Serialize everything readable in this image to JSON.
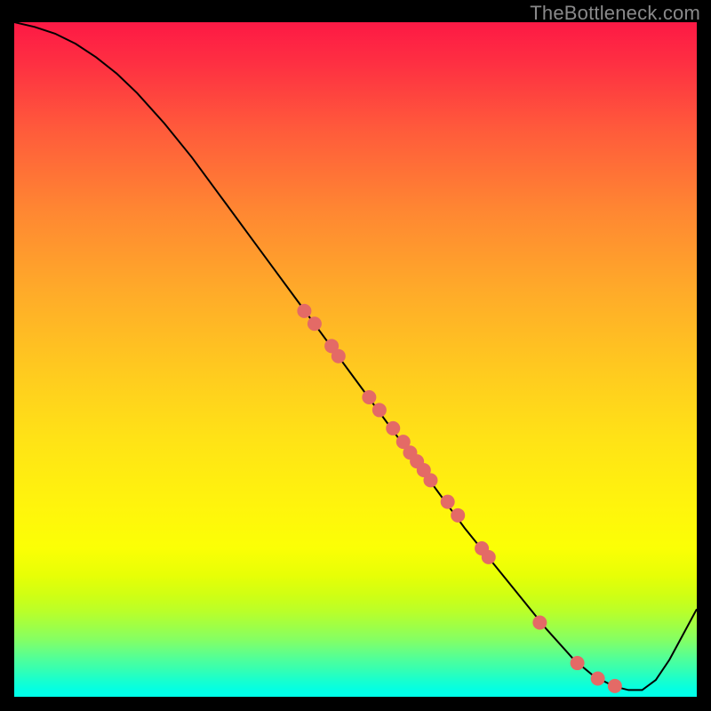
{
  "watermark": "TheBottleneck.com",
  "chart_data": {
    "type": "line",
    "title": "",
    "xlabel": "",
    "ylabel": "",
    "xlim": [
      0,
      100
    ],
    "ylim": [
      0,
      100
    ],
    "series": [
      {
        "name": "curve",
        "color": "#000000",
        "x": [
          0,
          3,
          6,
          9,
          12,
          15,
          18,
          22,
          26,
          30,
          34,
          38,
          42,
          46,
          50,
          54,
          58,
          62,
          66,
          70,
          74,
          78,
          82,
          85,
          88,
          90,
          92,
          94,
          96,
          100
        ],
        "y": [
          100,
          99.3,
          98.3,
          96.8,
          94.8,
          92.4,
          89.5,
          85,
          80,
          74.5,
          69,
          63.5,
          58,
          52.5,
          47,
          41.5,
          36,
          30.5,
          25,
          20,
          15,
          10,
          5.5,
          3,
          1.5,
          1,
          1,
          2.5,
          5.5,
          13
        ]
      }
    ],
    "points": {
      "name": "markers",
      "color": "#e46a66",
      "r": 8,
      "data": [
        {
          "x": 42.5,
          "y": 57.2
        },
        {
          "x": 44.0,
          "y": 55.3
        },
        {
          "x": 46.5,
          "y": 52.0
        },
        {
          "x": 47.5,
          "y": 50.5
        },
        {
          "x": 52.0,
          "y": 44.4
        },
        {
          "x": 53.5,
          "y": 42.5
        },
        {
          "x": 55.5,
          "y": 39.8
        },
        {
          "x": 57.0,
          "y": 37.8
        },
        {
          "x": 58.0,
          "y": 36.2
        },
        {
          "x": 59.0,
          "y": 34.9
        },
        {
          "x": 60.0,
          "y": 33.6
        },
        {
          "x": 61.0,
          "y": 32.1
        },
        {
          "x": 63.5,
          "y": 28.9
        },
        {
          "x": 65.0,
          "y": 26.9
        },
        {
          "x": 68.5,
          "y": 22.0
        },
        {
          "x": 69.5,
          "y": 20.7
        },
        {
          "x": 77.0,
          "y": 11.0
        },
        {
          "x": 82.5,
          "y": 5.0
        },
        {
          "x": 85.5,
          "y": 2.7
        },
        {
          "x": 88.0,
          "y": 1.6
        }
      ]
    }
  }
}
